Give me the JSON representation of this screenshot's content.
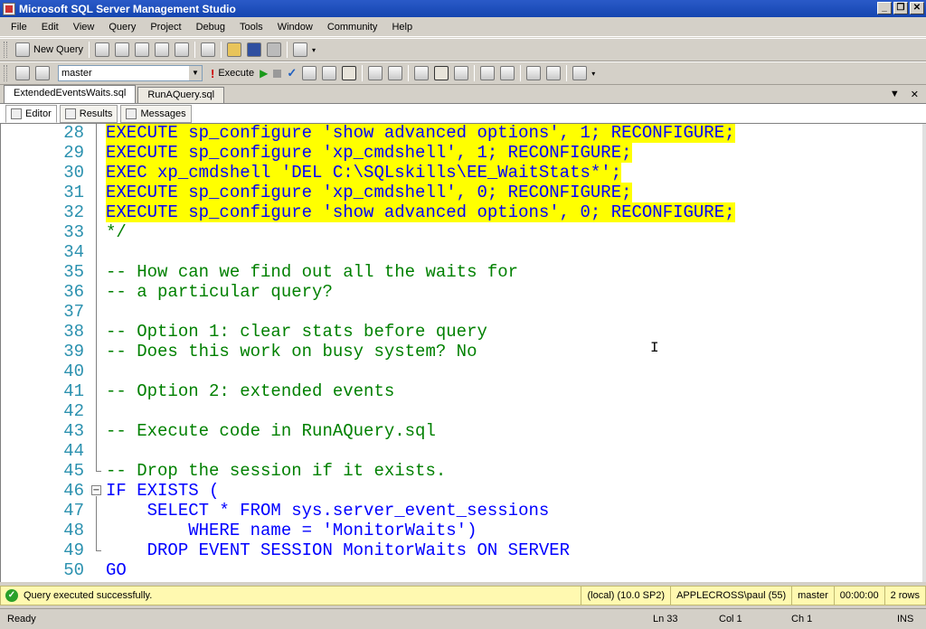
{
  "window": {
    "title": "Microsoft SQL Server Management Studio"
  },
  "menu": [
    "File",
    "Edit",
    "View",
    "Query",
    "Project",
    "Debug",
    "Tools",
    "Window",
    "Community",
    "Help"
  ],
  "toolbar": {
    "new_query_label": "New Query",
    "database": "master",
    "execute_label": "Execute"
  },
  "doc_tabs": [
    "ExtendedEventsWaits.sql",
    "RunAQuery.sql"
  ],
  "sub_tabs": [
    "Editor",
    "Results",
    "Messages"
  ],
  "code_lines": [
    {
      "n": "28",
      "t": "EXECUTE sp_configure 'show advanced options', 1; RECONFIGURE;"
    },
    {
      "n": "29",
      "t": "EXECUTE sp_configure 'xp_cmdshell', 1; RECONFIGURE;"
    },
    {
      "n": "30",
      "t": "EXEC xp_cmdshell 'DEL C:\\SQLskills\\EE_WaitStats*';"
    },
    {
      "n": "31",
      "t": "EXECUTE sp_configure 'xp_cmdshell', 0; RECONFIGURE;"
    },
    {
      "n": "32",
      "t": "EXECUTE sp_configure 'show advanced options', 0; RECONFIGURE;"
    },
    {
      "n": "33",
      "t": "*/"
    },
    {
      "n": "34",
      "t": ""
    },
    {
      "n": "35",
      "t": "-- How can we find out all the waits for"
    },
    {
      "n": "36",
      "t": "-- a particular query?"
    },
    {
      "n": "37",
      "t": ""
    },
    {
      "n": "38",
      "t": "-- Option 1: clear stats before query"
    },
    {
      "n": "39",
      "t": "-- Does this work on busy system? No"
    },
    {
      "n": "40",
      "t": ""
    },
    {
      "n": "41",
      "t": "-- Option 2: extended events"
    },
    {
      "n": "42",
      "t": ""
    },
    {
      "n": "43",
      "t": "-- Execute code in RunAQuery.sql"
    },
    {
      "n": "44",
      "t": ""
    },
    {
      "n": "45",
      "t": "-- Drop the session if it exists."
    },
    {
      "n": "46",
      "t": "IF EXISTS ("
    },
    {
      "n": "47",
      "t": "    SELECT * FROM sys.server_event_sessions"
    },
    {
      "n": "48",
      "t": "        WHERE name = 'MonitorWaits')"
    },
    {
      "n": "49",
      "t": "    DROP EVENT SESSION MonitorWaits ON SERVER"
    },
    {
      "n": "50",
      "t": "GO"
    }
  ],
  "status": {
    "message": "Query executed successfully.",
    "server": "(local) (10.0 SP2)",
    "user": "APPLECROSS\\paul (55)",
    "database": "master",
    "elapsed": "00:00:00",
    "rows": "2 rows"
  },
  "statusbar": {
    "ready": "Ready",
    "ln": "Ln 33",
    "col": "Col 1",
    "ch": "Ch 1",
    "mode": "INS"
  },
  "colors": {
    "highlight": "#ffff00",
    "keyword": "#0000ff",
    "comment": "#008000",
    "string": "#ff0000",
    "line_number": "#2b91af"
  }
}
